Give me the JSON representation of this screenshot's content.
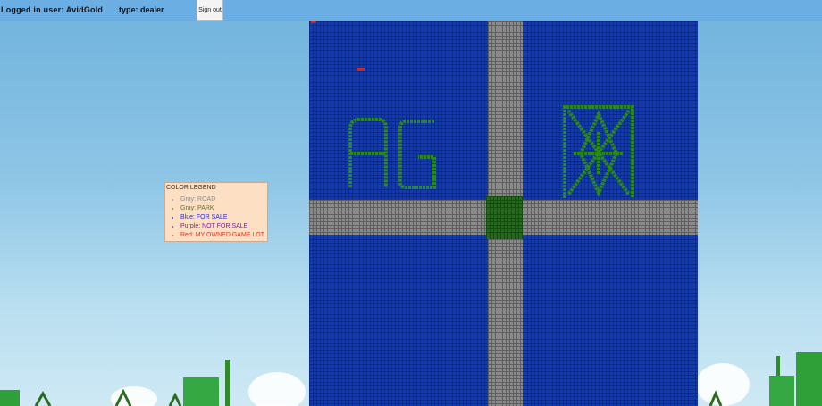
{
  "header": {
    "login_text": "Logged in user: AvidGold",
    "type_text": "type: dealer",
    "signout_label": "Sign out"
  },
  "legend": {
    "title": "COLOR LEGEND",
    "items": [
      {
        "label": "Gray: ROAD",
        "color": "#8a8a8a"
      },
      {
        "label": "Gray: PARK",
        "color": "#6b6b2f"
      },
      {
        "label": "Blue: FOR SALE",
        "color": "#2a2ad8"
      },
      {
        "label": "Purple: NOT FOR SALE",
        "color": "#7a1d8f"
      },
      {
        "label": "Red: MY OWNED GAME LOT",
        "color": "#e0331c"
      }
    ]
  },
  "map": {
    "lot_colors": {
      "for_sale": "#0b3cc9",
      "road": "#8a8a8a",
      "park": "#1f6e16",
      "owned": "#d0281c"
    }
  }
}
